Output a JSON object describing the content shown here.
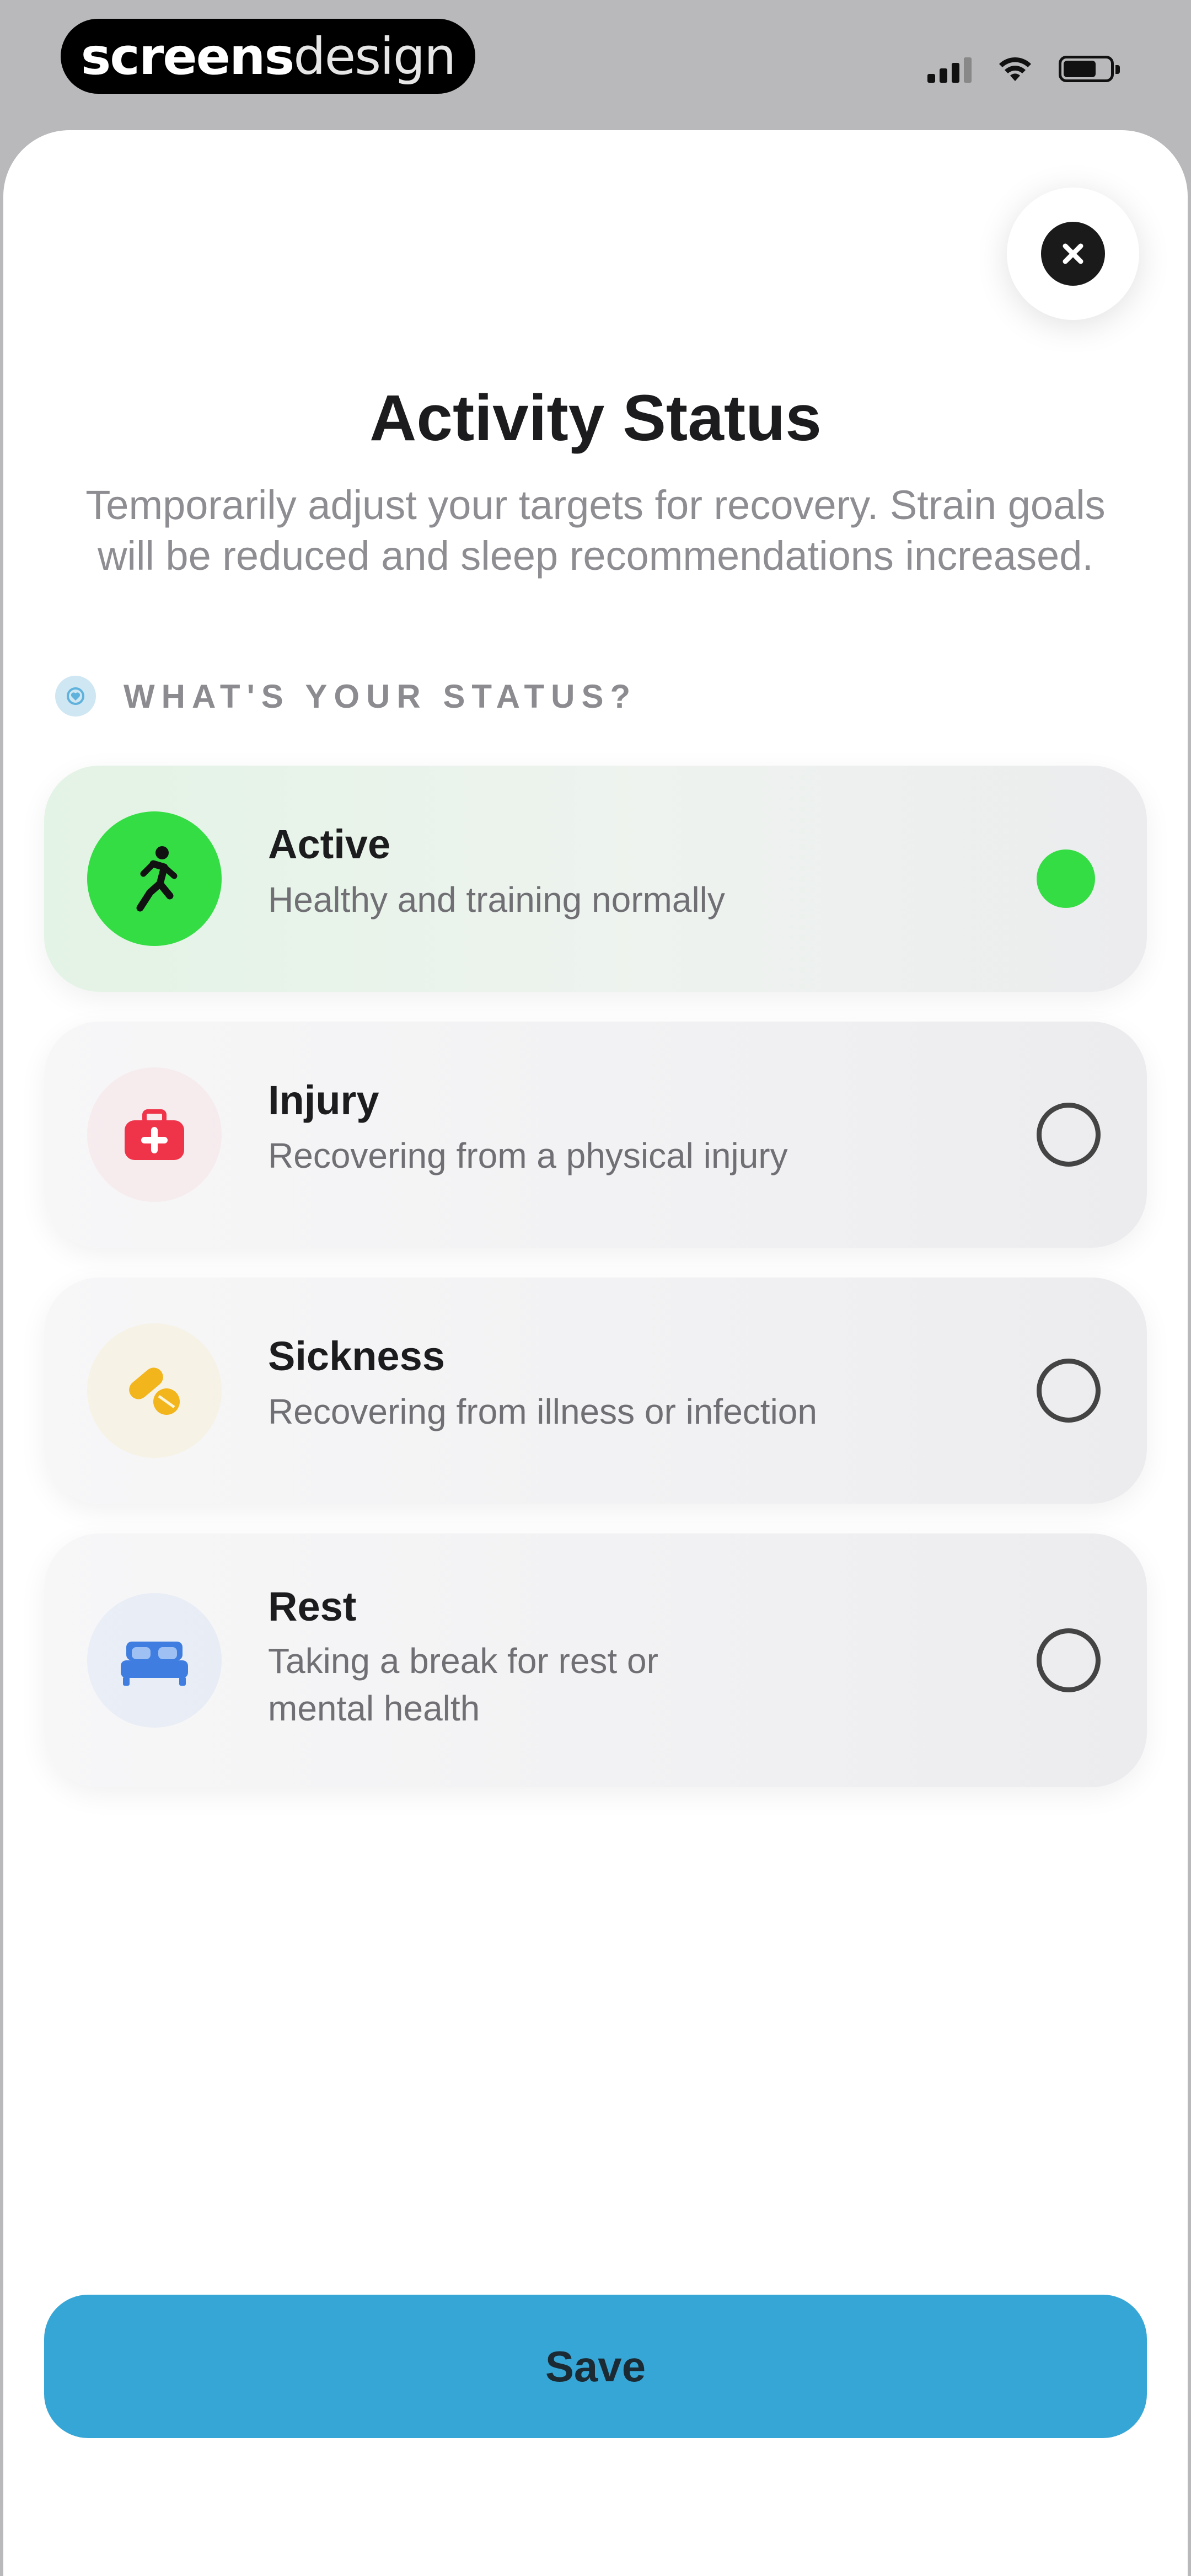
{
  "brand": {
    "bold": "screens",
    "light": "design"
  },
  "header": {
    "title": "Activity Status",
    "subtitle": "Temporarily adjust your targets for recovery. Strain goals will be reduced and sleep recommendations increased."
  },
  "section": {
    "label": "WHAT'S YOUR STATUS?"
  },
  "options": [
    {
      "title": "Active",
      "description": "Healthy and training normally",
      "selected": true,
      "icon": "running-person-icon",
      "color": "#35dd45"
    },
    {
      "title": "Injury",
      "description": "Recovering from a physical injury",
      "selected": false,
      "icon": "first-aid-kit-icon",
      "color": "#ef3349"
    },
    {
      "title": "Sickness",
      "description": "Recovering from illness or infection",
      "selected": false,
      "icon": "pills-icon",
      "color": "#f2b51c"
    },
    {
      "title": "Rest",
      "description": "Taking a break for rest or mental health",
      "selected": false,
      "icon": "bed-icon",
      "color": "#3f7ee0"
    }
  ],
  "footer": {
    "save_label": "Save"
  },
  "colors": {
    "accent": "#36a6d6",
    "selected": "#35dd45"
  }
}
